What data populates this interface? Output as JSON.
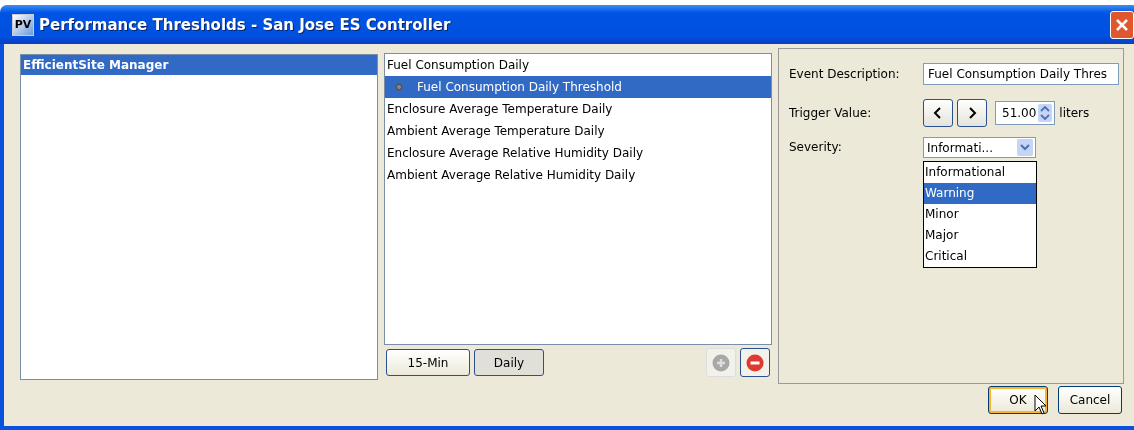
{
  "window": {
    "logo": "PV",
    "title": "Performance Thresholds - San Jose ES Controller"
  },
  "sites": [
    {
      "label": "EfficientSite Manager",
      "selected": true
    }
  ],
  "thresholds": [
    {
      "label": "Fuel Consumption Daily",
      "selected": false,
      "children": [
        {
          "label": "Fuel Consumption Daily Threshold",
          "selected": true
        }
      ]
    },
    {
      "label": "Enclosure Average Temperature Daily",
      "selected": false
    },
    {
      "label": "Ambient Average Temperature Daily",
      "selected": false
    },
    {
      "label": "Enclosure Average Relative Humidity Daily",
      "selected": false
    },
    {
      "label": "Ambient Average Relative Humidity Daily",
      "selected": false
    }
  ],
  "period_tabs": [
    {
      "label": "15-Min",
      "selected": false
    },
    {
      "label": "Daily",
      "selected": true
    }
  ],
  "add_enabled": false,
  "remove_enabled": true,
  "form": {
    "event_description_label": "Event Description:",
    "event_description": "Fuel Consumption Daily Thres",
    "trigger_label": "Trigger Value:",
    "trigger_value": "51.00",
    "unit": "liters",
    "severity_label": "Severity:",
    "severity": "Informati...",
    "severity_options": [
      {
        "label": "Informational",
        "selected": false
      },
      {
        "label": "Warning",
        "selected": true
      },
      {
        "label": "Minor",
        "selected": false
      },
      {
        "label": "Major",
        "selected": false
      },
      {
        "label": "Critical",
        "selected": false
      }
    ]
  },
  "buttons": [
    {
      "label": "OK",
      "focused": true
    },
    {
      "label": "Cancel",
      "focused": false
    }
  ]
}
